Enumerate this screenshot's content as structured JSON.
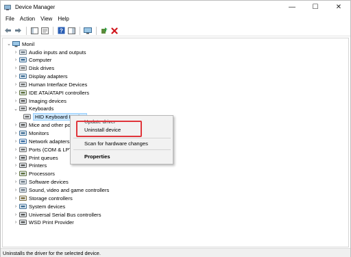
{
  "window": {
    "title": "Device Manager"
  },
  "caption": {
    "minimize_glyph": "—",
    "maximize_glyph": "☐",
    "close_glyph": "✕"
  },
  "menu": {
    "items": [
      "File",
      "Action",
      "View",
      "Help"
    ]
  },
  "toolbar": {
    "buttons": [
      "back-icon",
      "forward-icon",
      "show-hide-console-tree-icon",
      "properties-icon",
      "help-icon",
      "action-pane-icon",
      "monitor-icon",
      "update-driver-icon",
      "uninstall-icon"
    ]
  },
  "tree": {
    "root": "Monil",
    "nodes": [
      {
        "label": "Audio inputs and outputs",
        "icon": "speaker-icon"
      },
      {
        "label": "Computer",
        "icon": "computer-icon"
      },
      {
        "label": "Disk drives",
        "icon": "disk-icon"
      },
      {
        "label": "Display adapters",
        "icon": "display-icon"
      },
      {
        "label": "Human Interface Devices",
        "icon": "hid-icon"
      },
      {
        "label": "IDE ATA/ATAPI controllers",
        "icon": "ide-icon"
      },
      {
        "label": "Imaging devices",
        "icon": "camera-icon"
      },
      {
        "label": "Keyboards",
        "icon": "keyboard-icon",
        "expanded": true
      },
      {
        "label": "HID Keyboard Device",
        "icon": "keyboard-icon",
        "child": true,
        "selected": true
      },
      {
        "label": "Mice and other pointing devices",
        "icon": "mouse-icon"
      },
      {
        "label": "Monitors",
        "icon": "monitor-icon"
      },
      {
        "label": "Network adapters",
        "icon": "network-icon"
      },
      {
        "label": "Ports (COM & LPT)",
        "icon": "port-icon"
      },
      {
        "label": "Print queues",
        "icon": "printer-icon"
      },
      {
        "label": "Printers",
        "icon": "printer-icon"
      },
      {
        "label": "Processors",
        "icon": "cpu-icon"
      },
      {
        "label": "Software devices",
        "icon": "software-icon"
      },
      {
        "label": "Sound, video and game controllers",
        "icon": "sound-icon"
      },
      {
        "label": "Storage controllers",
        "icon": "storage-icon"
      },
      {
        "label": "System devices",
        "icon": "system-icon"
      },
      {
        "label": "Universal Serial Bus controllers",
        "icon": "usb-icon"
      },
      {
        "label": "WSD Print Provider",
        "icon": "printer-icon"
      }
    ]
  },
  "context_menu": {
    "items": {
      "update_driver": "Update driver",
      "uninstall_device": "Uninstall device",
      "scan": "Scan for hardware changes",
      "properties": "Properties"
    },
    "highlight_color": "#e0343a"
  },
  "status": {
    "text": "Uninstalls the driver for the selected device."
  }
}
